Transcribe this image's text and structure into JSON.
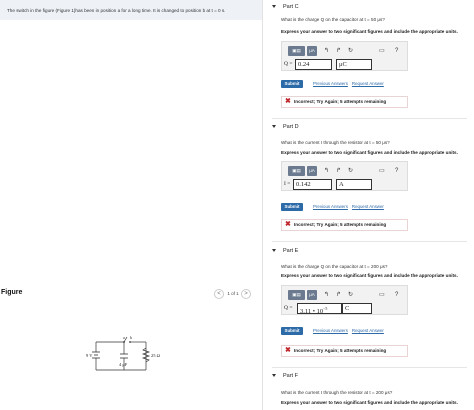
{
  "problem": {
    "statement": "The switch in the figure (Figure 1)has been in position a for a long time. It is changed to position b at t = 0 s."
  },
  "figure": {
    "label": "Figure",
    "pager_prev": "<",
    "pager_next": ">",
    "pager_text": "1 of 1",
    "circuit": {
      "battery": "9 V",
      "switch_a": "a",
      "switch_b": "b",
      "capacitor": "4 μF",
      "resistor": "25 Ω"
    }
  },
  "toolbar": {
    "templates_icon": "▣▤",
    "greek_label": "μA",
    "undo_icon": "↰",
    "redo_icon": "↱",
    "reset_icon": "↻",
    "keyboard_icon": "▭",
    "help_icon": "?"
  },
  "parts": [
    {
      "title": "Part C",
      "question": "What is the charge Q on the capacitor at t = 50 μs?",
      "instruction": "Express your answer to two significant figures and include the appropriate units.",
      "answer_label": "Q =",
      "value": "0.24",
      "unit": "μC",
      "submit": "Submit",
      "previous_answers": "Previous Answers",
      "request_answer": "Request Answer",
      "feedback": "Incorrect; Try Again; 5 attempts remaining"
    },
    {
      "title": "Part D",
      "question": "What is the current I through the resistor at t = 50 μs?",
      "instruction": "Express your answer to two significant figures and include the appropriate units.",
      "answer_label": "I =",
      "value": "0.142",
      "unit": "A",
      "submit": "Submit",
      "previous_answers": "Previous Answers",
      "request_answer": "Request Answer",
      "feedback": "Incorrect; Try Again; 5 attempts remaining"
    },
    {
      "title": "Part E",
      "question": "What is the charge Q on the capacitor at t = 200 μs?",
      "instruction": "Express your answer to two significant figures and include the appropriate units.",
      "answer_label": "Q =",
      "value": "3.11 • 10",
      "exponent": "−5",
      "unit": "C",
      "submit": "Submit",
      "previous_answers": "Previous Answers",
      "request_answer": "Request Answer",
      "feedback": "Incorrect; Try Again; 5 attempts remaining"
    },
    {
      "title": "Part F",
      "question": "What is the current I through the resistor at t = 200 μs?",
      "instruction": "Express your answer to two significant figures and include the appropriate units."
    }
  ]
}
